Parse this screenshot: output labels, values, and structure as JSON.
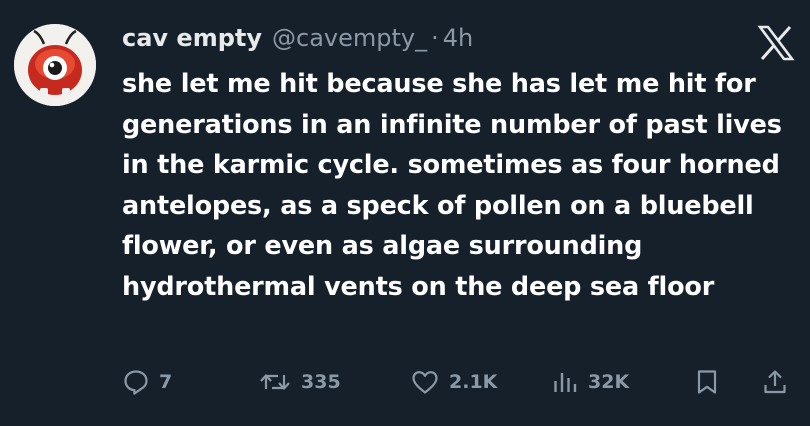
{
  "author": {
    "display_name": "cav empty",
    "handle": "@cavempty_",
    "separator": "·",
    "time": "4h"
  },
  "tweet": {
    "text": "she let me hit because she has let me hit for generations in an infinite number of past lives in the karmic cycle. sometimes as four horned antelopes, as a speck of pollen on a bluebell flower, or even as algae surrounding hydrothermal vents on the deep sea floor"
  },
  "metrics": {
    "replies": "7",
    "reposts": "335",
    "likes": "2.1K",
    "views": "32K"
  },
  "icons": [
    "x-logo-icon",
    "reply-icon",
    "repost-icon",
    "like-icon",
    "views-icon",
    "bookmark-icon",
    "share-icon"
  ],
  "colors": {
    "background": "#15202b",
    "text": "#ffffff",
    "muted": "#8b98a5"
  }
}
